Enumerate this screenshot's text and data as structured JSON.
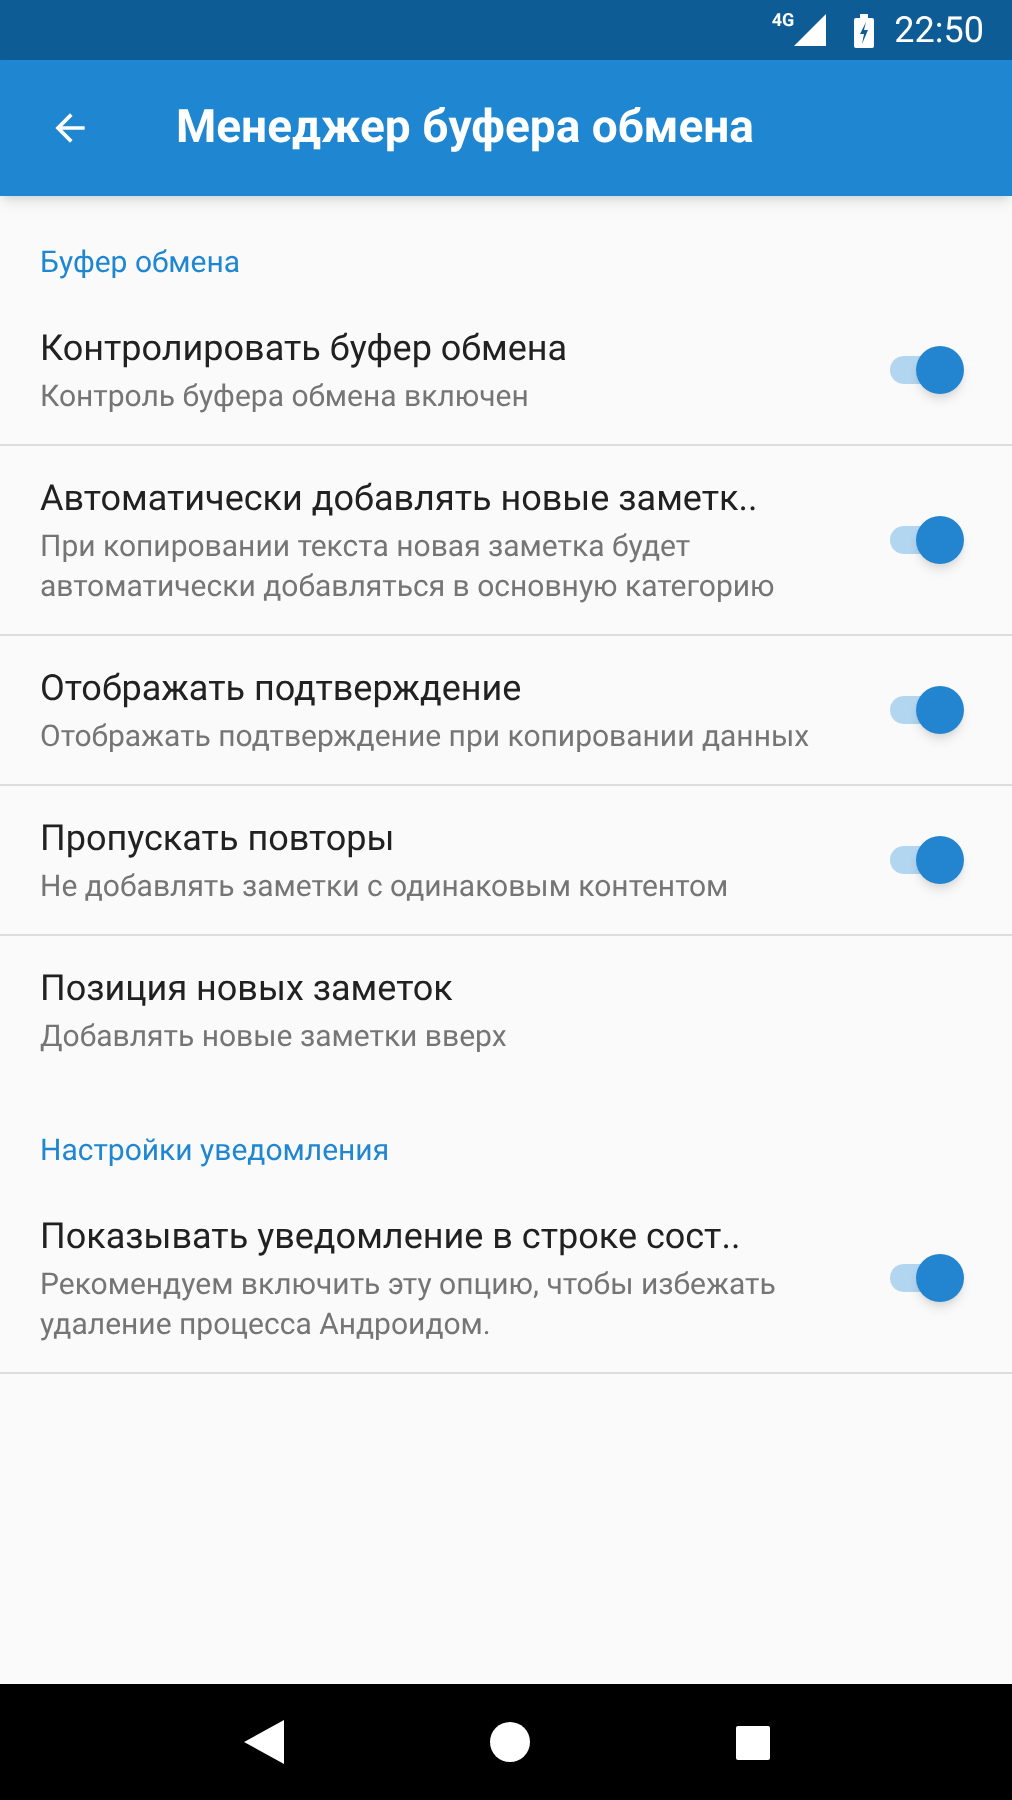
{
  "status_bar": {
    "network": "4G",
    "time": "22:50"
  },
  "app_bar": {
    "title": "Менеджер буфера обмена"
  },
  "sections": [
    {
      "header": "Буфер обмена",
      "items": [
        {
          "kind": "toggle",
          "title": "Контролировать буфер обмена",
          "summary": "Контроль буфера обмена включен",
          "on": true
        },
        {
          "kind": "toggle",
          "title": "Автоматически добавлять новые заметк..",
          "summary": "При копировании текста новая заметка будет автоматически добавляться в основную категорию",
          "on": true
        },
        {
          "kind": "toggle",
          "title": "Отображать подтверждение",
          "summary": "Отображать подтверждение при копировании данных",
          "on": true
        },
        {
          "kind": "toggle",
          "title": "Пропускать повторы",
          "summary": "Не добавлять заметки с одинаковым контентом",
          "on": true
        },
        {
          "kind": "plain",
          "title": "Позиция новых заметок",
          "summary": "Добавлять новые заметки вверх"
        }
      ]
    },
    {
      "header": "Настройки уведомления",
      "items": [
        {
          "kind": "toggle",
          "title": "Показывать уведомление в строке сост..",
          "summary": "Рекомендуем включить эту опцию, чтобы избежать удаление процесса Андроидом.",
          "on": true
        }
      ]
    }
  ]
}
